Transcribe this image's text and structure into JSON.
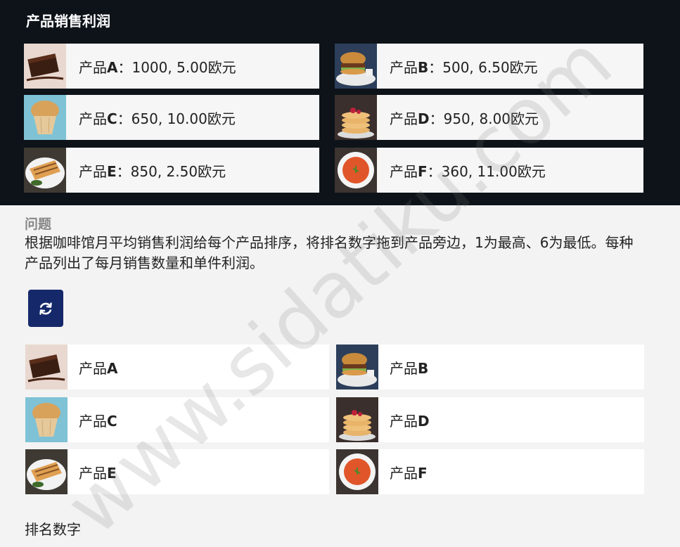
{
  "header": {
    "title": "产品销售利润"
  },
  "stats": [
    {
      "prefix": "产品",
      "letter": "A",
      "detail": "：1000, 5.00欧元",
      "image": "brownie"
    },
    {
      "prefix": "产品",
      "letter": "B",
      "detail": "：500, 6.50欧元",
      "image": "burger"
    },
    {
      "prefix": "产品",
      "letter": "C",
      "detail": "：650, 10.00欧元",
      "image": "muffin"
    },
    {
      "prefix": "产品",
      "letter": "D",
      "detail": "：950, 8.00欧元",
      "image": "pancakes"
    },
    {
      "prefix": "产品",
      "letter": "E",
      "detail": "：850, 2.50欧元",
      "image": "panini"
    },
    {
      "prefix": "产品",
      "letter": "F",
      "detail": "：360, 11.00欧元",
      "image": "soup"
    }
  ],
  "question": {
    "heading": "问题",
    "text": "根据咖啡馆月平均销售利润给每个产品排序，将排名数字拖到产品旁边，1为最高、6为最低。每种产品列出了每月销售数量和单件利润。"
  },
  "refresh": {
    "icon": "refresh-icon"
  },
  "products": [
    {
      "prefix": "产品",
      "letter": "A",
      "image": "brownie"
    },
    {
      "prefix": "产品",
      "letter": "B",
      "image": "burger"
    },
    {
      "prefix": "产品",
      "letter": "C",
      "image": "muffin"
    },
    {
      "prefix": "产品",
      "letter": "D",
      "image": "pancakes"
    },
    {
      "prefix": "产品",
      "letter": "E",
      "image": "panini"
    },
    {
      "prefix": "产品",
      "letter": "F",
      "image": "soup"
    }
  ],
  "ranking": {
    "label": "排名数字"
  },
  "watermark": {
    "text": "www.sidatiku.com"
  },
  "colors": {
    "top_panel": "#0d1319",
    "refresh_button": "#15296a",
    "muted_heading": "#888888"
  }
}
